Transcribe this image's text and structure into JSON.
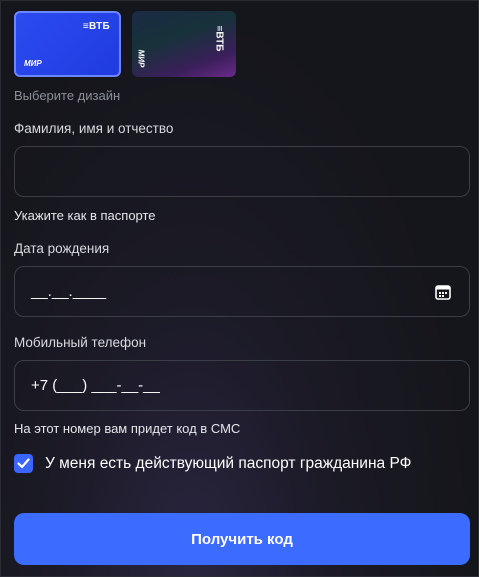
{
  "cards": {
    "blue": {
      "bank": "≡ВТБ",
      "pay": "МИР"
    },
    "dark": {
      "bank": "≡ВТБ",
      "pay": "МИР"
    },
    "caption": "Выберите дизайн"
  },
  "fio": {
    "label": "Фамилия, имя и отчество",
    "value": "",
    "hint": "Укажите как в паспорте"
  },
  "birth": {
    "label": "Дата рождения",
    "value": "__.__.____",
    "icon": "calendar-icon"
  },
  "phone": {
    "label": "Мобильный телефон",
    "value": "+7 (___) ___-__-__",
    "hint": "На этот номер вам придет код в СМС"
  },
  "passport": {
    "checked": true,
    "label": "У меня есть действующий паспорт гражданина РФ"
  },
  "submit": {
    "label": "Получить код"
  },
  "colors": {
    "accent": "#3b6bff",
    "background": "#15161b",
    "border": "#3b3d47"
  }
}
